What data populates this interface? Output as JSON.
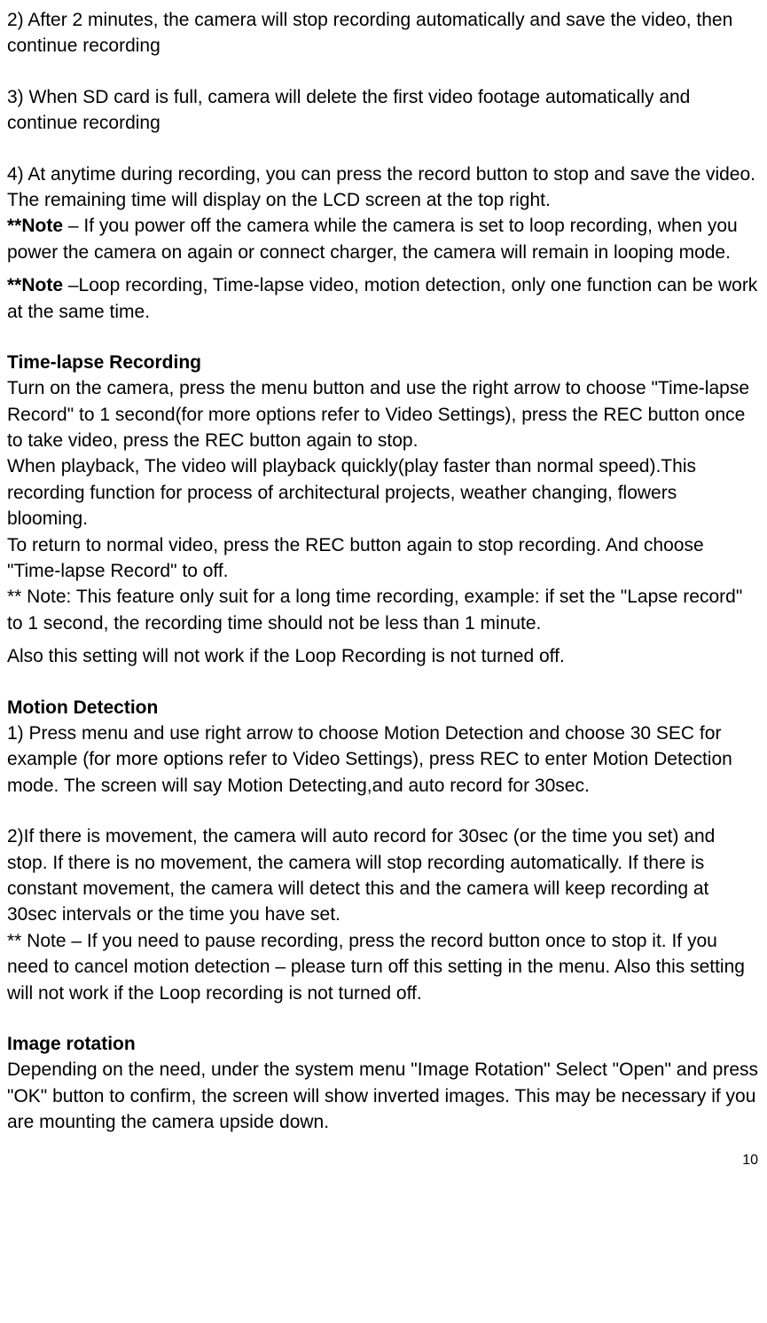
{
  "p1": "2) After 2 minutes, the camera will stop recording automatically and save the video, then continue recording",
  "p2": "3) When SD card is full, camera will delete the first video footage automatically and continue recording",
  "p3": "4) At anytime during recording, you can press the record button to stop and save the video.    The remaining time will display on the LCD screen at the top right.",
  "note1_label": "**Note",
  "note1_text": " – If you power off the camera while the camera is set to loop recording, when you power the camera on again or connect charger, the camera will remain in looping mode.",
  "note2_label": "**Note",
  "note2_text": " –Loop recording, Time-lapse video, motion detection, only one function can be work at the same time.",
  "h1": "Time-lapse Recording",
  "p4": "Turn on the camera, press the menu button and use the right arrow to choose \"Time-lapse Record\" to 1 second(for more options refer to Video Settings),    press the REC button once to take video, press the REC button again to stop.",
  "p5": "When playback, The video will playback quickly(play faster than normal speed).This recording function for process of architectural projects, weather changing, flowers blooming.",
  "p6": "To return to normal video, press the REC button again to stop recording. And choose \"Time-lapse Record\" to off.",
  "p7": "** Note: This feature only suit for a long time recording, example: if set the \"Lapse record\" to 1 second, the recording time should not be less than 1 minute.",
  "p8": "Also this setting will not work if the Loop Recording is not turned off.",
  "h2": "Motion Detection",
  "p9": "1) Press menu and use right arrow to choose Motion Detection and choose 30 SEC for example (for more options refer to Video Settings), press REC to enter Motion Detection mode.    The screen will say Motion Detecting,and auto record for 30sec.",
  "p10": "2)If there is movement, the camera will auto record for 30sec (or the time you set) and stop. If there is no movement, the camera will stop recording automatically. If there is constant movement, the camera will detect this and the camera will keep recording at 30sec intervals or the time you have set.",
  "p11": "** Note – If you need to pause recording, press the record button once to stop it. If you need to cancel motion detection – please turn off this setting in the menu.    Also this setting will not work if the Loop recording is not turned off.",
  "h3": "Image rotation",
  "p12": "Depending on the need, under the system menu \"Image Rotation\" Select \"Open\" and press \"OK\" button to confirm, the screen will show inverted images.    This may be necessary if you are mounting the camera upside down.",
  "page_number": "10"
}
